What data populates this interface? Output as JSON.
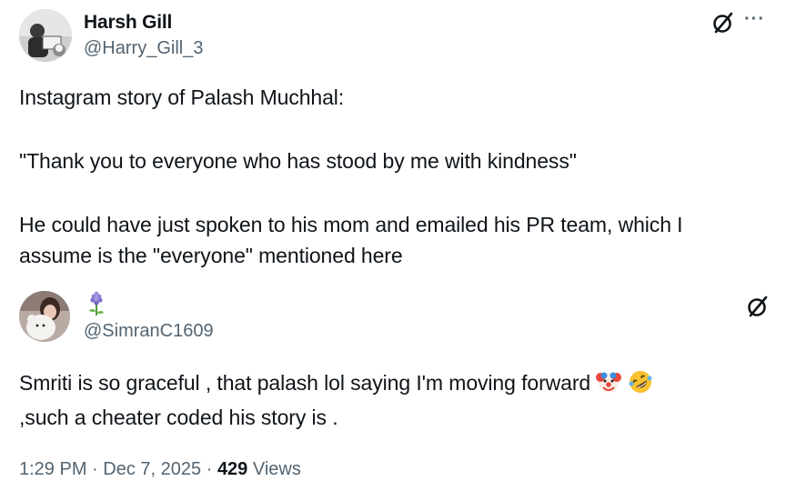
{
  "quoted_tweet": {
    "author_name": "Harsh Gill",
    "author_handle": "@Harry_Gill_3",
    "lines": [
      "Instagram story of Palash Muchhal:",
      "\"Thank you to everyone who has stood by me with kindness\"",
      "He could have just spoken to his mom and emailed his PR team, which I",
      "assume is the \"everyone\" mentioned here"
    ],
    "more_label": "···"
  },
  "reply_tweet": {
    "author_handle": "@SimranC1609",
    "name_icon": "hyacinth-flower-icon",
    "lines": [
      "Smriti is so graceful , that palash lol saying I'm moving forward",
      ",such a cheater coded his story is ."
    ],
    "emojis": [
      "clown-face-icon",
      "rolling-laughing-icon"
    ]
  },
  "meta": {
    "time": "1:29 PM",
    "separator": "·",
    "date": "Dec 7, 2025",
    "views_count": "429",
    "views_label": "Views"
  },
  "colors": {
    "text": "#0f1419",
    "secondary": "#536471",
    "background": "#ffffff"
  }
}
